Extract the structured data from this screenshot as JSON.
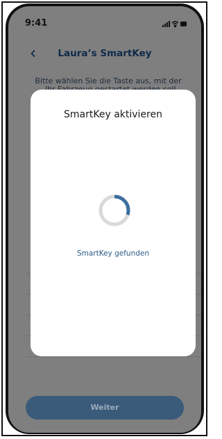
{
  "status_bar": {
    "time": "9:41",
    "icons": [
      "signal-icon",
      "wifi-icon",
      "battery-icon"
    ]
  },
  "nav": {
    "back_icon": "chevron-left-icon",
    "title": "Laura’s SmartKey"
  },
  "intro": {
    "text": "Bitte wählen Sie die Taste aus, mit der",
    "text_partial": "Ihr Fahrzeug gestartet werden soll."
  },
  "modal": {
    "title": "SmartKey aktivieren",
    "status": "SmartKey gefunden",
    "progress": 0.3
  },
  "footer": {
    "button_label": "Weiter"
  },
  "colors": {
    "overlay": "#7f7f7f",
    "accent": "#3c6e9e",
    "title": "#0f2a4a",
    "button": "#3a5a79"
  }
}
